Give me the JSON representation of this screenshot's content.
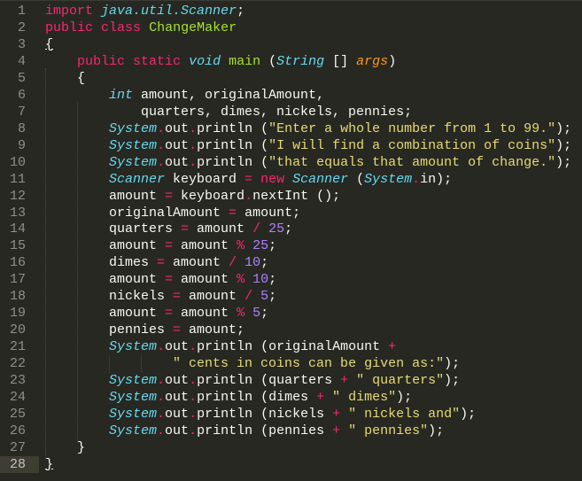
{
  "editor": {
    "theme_colors": {
      "background": "#272822",
      "keyword": "#f92672",
      "type": "#66d9ef",
      "class_name": "#a6e22e",
      "string": "#e6db74",
      "number": "#ae81ff",
      "argument": "#fd971f",
      "plain": "#f8f8f2",
      "gutter_text": "#90908a",
      "current_line_gutter": "#3e3d32"
    },
    "current_line": 28,
    "lines": [
      {
        "n": "1",
        "tokens": [
          [
            "kw",
            "import"
          ],
          [
            "pl",
            " "
          ],
          [
            "st",
            "java.util.Scanner"
          ],
          [
            "pl",
            ";"
          ]
        ]
      },
      {
        "n": "2",
        "tokens": [
          [
            "kw",
            "public"
          ],
          [
            "pl",
            " "
          ],
          [
            "kw",
            "class"
          ],
          [
            "pl",
            " "
          ],
          [
            "cls",
            "ChangeMaker"
          ]
        ]
      },
      {
        "n": "3",
        "tokens": [
          [
            "br-match",
            "{"
          ]
        ]
      },
      {
        "n": "4",
        "tokens": [
          [
            "pl",
            "    "
          ],
          [
            "kw",
            "public"
          ],
          [
            "pl",
            " "
          ],
          [
            "kw",
            "static"
          ],
          [
            "pl",
            " "
          ],
          [
            "st",
            "void"
          ],
          [
            "pl",
            " "
          ],
          [
            "fn",
            "main"
          ],
          [
            "pl",
            " ("
          ],
          [
            "st",
            "String"
          ],
          [
            "pl",
            " [] "
          ],
          [
            "arg",
            "args"
          ],
          [
            "pl",
            ")"
          ]
        ]
      },
      {
        "n": "5",
        "tokens": [
          [
            "pl",
            "    {"
          ]
        ]
      },
      {
        "n": "6",
        "tokens": [
          [
            "pl",
            "        "
          ],
          [
            "st",
            "int"
          ],
          [
            "pl",
            " amount, originalAmount,"
          ]
        ]
      },
      {
        "n": "7",
        "tokens": [
          [
            "pl",
            "            quarters, dimes, nickels, pennies;"
          ]
        ]
      },
      {
        "n": "8",
        "tokens": [
          [
            "pl",
            "        "
          ],
          [
            "st",
            "System"
          ],
          [
            "op",
            "."
          ],
          [
            "pl",
            "out"
          ],
          [
            "op",
            "."
          ],
          [
            "pl",
            "println ("
          ],
          [
            "str",
            "\"Enter a whole number from 1 to 99.\""
          ],
          [
            "pl",
            ");"
          ]
        ]
      },
      {
        "n": "9",
        "tokens": [
          [
            "pl",
            "        "
          ],
          [
            "st",
            "System"
          ],
          [
            "op",
            "."
          ],
          [
            "pl",
            "out"
          ],
          [
            "op",
            "."
          ],
          [
            "pl",
            "println ("
          ],
          [
            "str",
            "\"I will find a combination of coins\""
          ],
          [
            "pl",
            ");"
          ]
        ]
      },
      {
        "n": "10",
        "tokens": [
          [
            "pl",
            "        "
          ],
          [
            "st",
            "System"
          ],
          [
            "op",
            "."
          ],
          [
            "pl",
            "out"
          ],
          [
            "op",
            "."
          ],
          [
            "pl",
            "println ("
          ],
          [
            "str",
            "\"that equals that amount of change.\""
          ],
          [
            "pl",
            ");"
          ]
        ]
      },
      {
        "n": "11",
        "tokens": [
          [
            "pl",
            "        "
          ],
          [
            "st",
            "Scanner"
          ],
          [
            "pl",
            " keyboard "
          ],
          [
            "op",
            "="
          ],
          [
            "pl",
            " "
          ],
          [
            "kw",
            "new"
          ],
          [
            "pl",
            " "
          ],
          [
            "st",
            "Scanner"
          ],
          [
            "pl",
            " ("
          ],
          [
            "st",
            "System"
          ],
          [
            "op",
            "."
          ],
          [
            "pl",
            "in);"
          ]
        ]
      },
      {
        "n": "12",
        "tokens": [
          [
            "pl",
            "        amount "
          ],
          [
            "op",
            "="
          ],
          [
            "pl",
            " keyboard"
          ],
          [
            "op",
            "."
          ],
          [
            "pl",
            "nextInt ();"
          ]
        ]
      },
      {
        "n": "13",
        "tokens": [
          [
            "pl",
            "        originalAmount "
          ],
          [
            "op",
            "="
          ],
          [
            "pl",
            " amount;"
          ]
        ]
      },
      {
        "n": "14",
        "tokens": [
          [
            "pl",
            "        quarters "
          ],
          [
            "op",
            "="
          ],
          [
            "pl",
            " amount "
          ],
          [
            "op",
            "/"
          ],
          [
            "pl",
            " "
          ],
          [
            "num",
            "25"
          ],
          [
            "pl",
            ";"
          ]
        ]
      },
      {
        "n": "15",
        "tokens": [
          [
            "pl",
            "        amount "
          ],
          [
            "op",
            "="
          ],
          [
            "pl",
            " amount "
          ],
          [
            "op",
            "%"
          ],
          [
            "pl",
            " "
          ],
          [
            "num",
            "25"
          ],
          [
            "pl",
            ";"
          ]
        ]
      },
      {
        "n": "16",
        "tokens": [
          [
            "pl",
            "        dimes "
          ],
          [
            "op",
            "="
          ],
          [
            "pl",
            " amount "
          ],
          [
            "op",
            "/"
          ],
          [
            "pl",
            " "
          ],
          [
            "num",
            "10"
          ],
          [
            "pl",
            ";"
          ]
        ]
      },
      {
        "n": "17",
        "tokens": [
          [
            "pl",
            "        amount "
          ],
          [
            "op",
            "="
          ],
          [
            "pl",
            " amount "
          ],
          [
            "op",
            "%"
          ],
          [
            "pl",
            " "
          ],
          [
            "num",
            "10"
          ],
          [
            "pl",
            ";"
          ]
        ]
      },
      {
        "n": "18",
        "tokens": [
          [
            "pl",
            "        nickels "
          ],
          [
            "op",
            "="
          ],
          [
            "pl",
            " amount "
          ],
          [
            "op",
            "/"
          ],
          [
            "pl",
            " "
          ],
          [
            "num",
            "5"
          ],
          [
            "pl",
            ";"
          ]
        ]
      },
      {
        "n": "19",
        "tokens": [
          [
            "pl",
            "        amount "
          ],
          [
            "op",
            "="
          ],
          [
            "pl",
            " amount "
          ],
          [
            "op",
            "%"
          ],
          [
            "pl",
            " "
          ],
          [
            "num",
            "5"
          ],
          [
            "pl",
            ";"
          ]
        ]
      },
      {
        "n": "20",
        "tokens": [
          [
            "pl",
            "        pennies "
          ],
          [
            "op",
            "="
          ],
          [
            "pl",
            " amount;"
          ]
        ]
      },
      {
        "n": "21",
        "tokens": [
          [
            "pl",
            "        "
          ],
          [
            "st",
            "System"
          ],
          [
            "op",
            "."
          ],
          [
            "pl",
            "out"
          ],
          [
            "op",
            "."
          ],
          [
            "pl",
            "println (originalAmount "
          ],
          [
            "op",
            "+"
          ]
        ]
      },
      {
        "n": "22",
        "tokens": [
          [
            "pl",
            "                "
          ],
          [
            "str",
            "\" cents in coins can be given as:\""
          ],
          [
            "pl",
            ");"
          ]
        ]
      },
      {
        "n": "23",
        "tokens": [
          [
            "pl",
            "        "
          ],
          [
            "st",
            "System"
          ],
          [
            "op",
            "."
          ],
          [
            "pl",
            "out"
          ],
          [
            "op",
            "."
          ],
          [
            "pl",
            "println (quarters "
          ],
          [
            "op",
            "+"
          ],
          [
            "pl",
            " "
          ],
          [
            "str",
            "\" quarters\""
          ],
          [
            "pl",
            ");"
          ]
        ]
      },
      {
        "n": "24",
        "tokens": [
          [
            "pl",
            "        "
          ],
          [
            "st",
            "System"
          ],
          [
            "op",
            "."
          ],
          [
            "pl",
            "out"
          ],
          [
            "op",
            "."
          ],
          [
            "pl",
            "println (dimes "
          ],
          [
            "op",
            "+"
          ],
          [
            "pl",
            " "
          ],
          [
            "str",
            "\" dimes\""
          ],
          [
            "pl",
            ");"
          ]
        ]
      },
      {
        "n": "25",
        "tokens": [
          [
            "pl",
            "        "
          ],
          [
            "st",
            "System"
          ],
          [
            "op",
            "."
          ],
          [
            "pl",
            "out"
          ],
          [
            "op",
            "."
          ],
          [
            "pl",
            "println (nickels "
          ],
          [
            "op",
            "+"
          ],
          [
            "pl",
            " "
          ],
          [
            "str",
            "\" nickels and\""
          ],
          [
            "pl",
            ");"
          ]
        ]
      },
      {
        "n": "26",
        "tokens": [
          [
            "pl",
            "        "
          ],
          [
            "st",
            "System"
          ],
          [
            "op",
            "."
          ],
          [
            "pl",
            "out"
          ],
          [
            "op",
            "."
          ],
          [
            "pl",
            "println (pennies "
          ],
          [
            "op",
            "+"
          ],
          [
            "pl",
            " "
          ],
          [
            "str",
            "\" pennies\""
          ],
          [
            "pl",
            ");"
          ]
        ]
      },
      {
        "n": "27",
        "tokens": [
          [
            "pl",
            "    }"
          ]
        ]
      },
      {
        "n": "28",
        "tokens": [
          [
            "br-match",
            "}"
          ]
        ]
      }
    ]
  }
}
